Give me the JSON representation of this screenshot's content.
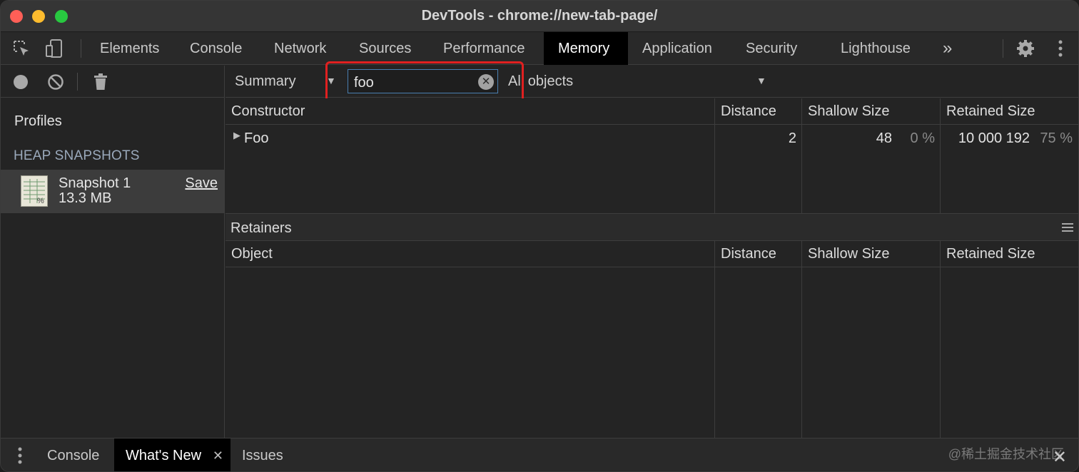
{
  "window": {
    "title": "DevTools - chrome://new-tab-page/"
  },
  "tabs": [
    {
      "label": "Elements"
    },
    {
      "label": "Console"
    },
    {
      "label": "Network"
    },
    {
      "label": "Sources"
    },
    {
      "label": "Performance"
    },
    {
      "label": "Memory"
    },
    {
      "label": "Application"
    },
    {
      "label": "Security"
    },
    {
      "label": "Lighthouse"
    }
  ],
  "active_tab": "Memory",
  "more_tabs_label": "»",
  "sidebar": {
    "profiles_label": "Profiles",
    "section_heading": "HEAP SNAPSHOTS",
    "snapshot": {
      "name": "Snapshot 1",
      "size": "13.3 MB",
      "save_label": "Save"
    }
  },
  "toolbar": {
    "view": "Summary",
    "filter_value": "foo",
    "objects_filter": "All objects"
  },
  "constructors_table": {
    "headers": [
      "Constructor",
      "Distance",
      "Shallow Size",
      "Retained Size"
    ],
    "rows": [
      {
        "name": "Foo",
        "distance": "2",
        "shallow": "48",
        "shallow_pct": "0 %",
        "retained": "10 000 192",
        "retained_pct": "75 %"
      }
    ]
  },
  "retainers": {
    "title": "Retainers",
    "headers": [
      "Object",
      "Distance",
      "Shallow Size",
      "Retained Size"
    ]
  },
  "drawer": {
    "tabs": [
      {
        "label": "Console"
      },
      {
        "label": "What's New"
      },
      {
        "label": "Issues"
      }
    ],
    "watermark": "@稀土掘金技术社区"
  },
  "colors": {
    "accent_highlight": "#e02020",
    "active_tab_bg": "#000000",
    "panel_bg": "#242424"
  }
}
